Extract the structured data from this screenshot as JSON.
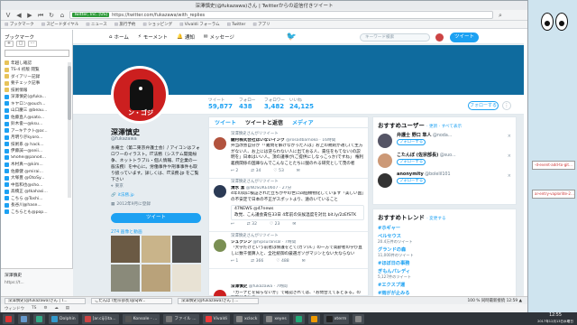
{
  "window_title": "深澤慎史(@fukazawa)さん | Twitterからの返信付きツイート",
  "url": {
    "badge": "Twitter, Inc. [US]",
    "text": "https://twitter.com/fukazawa/with_replies"
  },
  "bookmark_bar": [
    "ブックマーク",
    "スピードダイヤル",
    "ニュース",
    "旅行予約",
    "ショッピング",
    "Vivaldi フォーラム",
    "Twitter",
    "アプリ"
  ],
  "sidebar": {
    "title": "ブックマーク",
    "tools": [
      "+",
      "▢",
      "⋯"
    ],
    "items": [
      {
        "label": "年越し確認",
        "type": "folder"
      },
      {
        "label": "TS-4 初版 閲覧",
        "type": "folder"
      },
      {
        "label": "ダイアリー記録",
        "type": "folder"
      },
      {
        "label": "要チェック記事",
        "type": "folder"
      },
      {
        "label": "技術情報",
        "type": "folder"
      },
      {
        "label": "深澤慎史(@fuka...",
        "type": "link"
      },
      {
        "label": "キヤロン@ouch...",
        "type": "link"
      },
      {
        "label": "山口慶三 @beau...",
        "type": "link"
      },
      {
        "label": "佐藤直人@sato...",
        "type": "link"
      },
      {
        "label": "鈴木俊一@ksu...",
        "type": "link"
      },
      {
        "label": "アーキテクト@ar...",
        "type": "link"
      },
      {
        "label": "月明り＠kyoro...",
        "type": "link"
      },
      {
        "label": "技術系 @ hack...",
        "type": "link"
      },
      {
        "label": "伊藤誠一@seii...",
        "type": "link"
      },
      {
        "label": "Shohei@pano4...",
        "type": "link"
      },
      {
        "label": "木村真一@kim...",
        "type": "link"
      },
      {
        "label": "佐藤健 @mirai...",
        "type": "link"
      },
      {
        "label": "大塚豊 @OtoSy...",
        "type": "link"
      },
      {
        "label": "中島和也@sho...",
        "type": "link"
      },
      {
        "label": "高橋正 @tkahasi...",
        "type": "link"
      },
      {
        "label": "こちら @Toshi...",
        "type": "link"
      },
      {
        "label": "長谷川@hase...",
        "type": "link"
      },
      {
        "label": "こちらとも@pop...",
        "type": "link"
      }
    ],
    "dev_label": "深澤慎史",
    "dev_url": "https://t...",
    "dev_date": "2017年12月13日 12:55:22"
  },
  "twitter": {
    "nav": [
      {
        "icon": "⌂",
        "label": "ホーム"
      },
      {
        "icon": "⚡",
        "label": "モーメント"
      },
      {
        "icon": "🔔",
        "label": "通知"
      },
      {
        "icon": "✉",
        "label": "メッセージ"
      }
    ],
    "search_placeholder": "キーワード検索",
    "tweet_button": "ツイート",
    "stats": [
      {
        "label": "ツイート",
        "value": "59,877"
      },
      {
        "label": "フォロー",
        "value": "438"
      },
      {
        "label": "フォロワー",
        "value": "3,482"
      },
      {
        "label": "いいね",
        "value": "24,125"
      }
    ],
    "follow_button": "フォローする",
    "avatar_text": "ン・ゴジ",
    "profile": {
      "name": "深澤慎史",
      "handle": "@fukazawa",
      "bio": "糸庵士（第二東京弁護士会）/ アイコンはフォロワーのイラスト。IT法務（システム開発紛争、ネットトラブル・個人情報、IT企業の一般法務）を中心に。労働事件や刑事事件も取り扱っています。詳しくは、IT法務.jp をご覧下さい",
      "location": "東京",
      "link": "it法務.jp",
      "joined": "2012年9月に登録",
      "tweet_button": "ツイート",
      "media_label": "274 画像と動画"
    },
    "tabs": [
      "ツイート",
      "ツイートと返信",
      "メディア"
    ],
    "tweets": [
      {
        "rt": "深澤慎史さんがリツイート",
        "name": "鍵村株式会社はいないインク",
        "handle": "@rosadbamoko · 16時間",
        "text": "弁当改善自分が「「難問を解けなかった人は」お上の規則が適し(て生方がない人、お上には逆らわない人に出ておる人、責任をもてない)の説明を」日本はいい人。頂の議事が(ご提供にしなっこっか)ですね」 権利義務関係の国庫なんでこんなことたちに酸のれる研究として茂の者",
        "reply": "2",
        "rt_count": "34",
        "like": "53"
      },
      {
        "rt": "深澤慎史さんがリツイート",
        "name": "清水 潔",
        "handle": "@NOSUKE0607 · 27分",
        "text": "4年の間に検証された立ちがやの世に四個類物化しています「美しい国」の不安定で日本の不正がスポットより、遠のいていること",
        "extra": "47NEWS @47news\n政党、こん議会責任33日 4年前の気候温度を対比 bit.ly/2zEfSTK",
        "reply": "",
        "rt_count": "32",
        "like": "23"
      },
      {
        "rt": "深澤慎史さんがリツイート",
        "name": "シュクシン",
        "handle": "@hipsuransal · 7時間",
        "text": "「大学だけという前者は保護をとて(ガソ)ル」の一方で高齢者の学び直しに数千億算入と、全社統御の厳選ガソがマジンとない大ならない",
        "reply": "1",
        "rt_count": "366",
        "like": "488"
      },
      {
        "rt": "",
        "name": "深澤慎史",
        "handle": "@fukazawa · 7時間",
        "text": "「カーナビを知らないか」で確認されては、「お問合えてまとまる。の判断はそれる",
        "reply": "",
        "rt_count": "",
        "like": ""
      }
    ],
    "wtf": {
      "title": "おすすめユーザー",
      "more": "· 更新 · すべて表示",
      "users": [
        {
          "name": "弁護士 野口 隼人",
          "handle": "@noda...",
          "button": "フォローする"
        },
        {
          "name": "こたんぼ (佐宗部長)",
          "handle": "@suo...",
          "button": "フォローする"
        },
        {
          "name": "anonymity",
          "handle": "@bolelil101",
          "button": "フォローする"
        }
      ]
    },
    "trends": {
      "title": "おすすめトレンド",
      "more": "· 変更する",
      "items": [
        {
          "name": "#ホギャー",
          "count": ""
        },
        {
          "name": "ペルセウス",
          "count": "20.4万件のツイート"
        },
        {
          "name": "グランドの森",
          "count": "11,000件のツイート"
        },
        {
          "name": "#ほぼ日の事務",
          "count": ""
        },
        {
          "name": "ぎもんパレディ",
          "count": "5,127件のツイート"
        },
        {
          "name": "#エクスプ運",
          "count": ""
        },
        {
          "name": "#雨がが止みる",
          "count": "2,800件のツイート"
        },
        {
          "name": "ウインター",
          "count": ""
        }
      ]
    }
  },
  "status_tabs": [
    "深澤慎史(@fukazawa)さん | T...",
    "こたんぼ (佐宗部長)@SJW...",
    "深澤慎史(@fukazawa)さん | ..."
  ],
  "status_right": "100 %  同時最新接続  12:59 ▲",
  "browser_bottom": [
    "ウィンドウ",
    "TS",
    "⚙",
    "☁",
    "▤"
  ],
  "desktop": {
    "box1": "-d-event-add-to-github-pa...",
    "box2": "ar-entry-vaplorlite-2017/1"
  },
  "taskbar": [
    {
      "label": "",
      "color": "#d33"
    },
    {
      "label": "",
      "color": "#69c"
    },
    {
      "label": "",
      "color": "#3a8"
    },
    {
      "label": "Dolphin",
      "color": "#39c"
    },
    {
      "label": "[ar.ciji]ita...",
      "color": "#c44"
    },
    {
      "label": "Konsole - ...",
      "color": "#555"
    },
    {
      "label": "ファイル ...",
      "color": "#777"
    },
    {
      "label": "Vivaldi",
      "color": "#ef3939"
    },
    {
      "label": "xclock",
      "color": "#888"
    },
    {
      "label": "xeyes",
      "color": "#888"
    },
    {
      "label": "",
      "color": "#2a7"
    },
    {
      "label": "",
      "color": "#e90"
    },
    {
      "label": "xterm",
      "color": "#222"
    },
    {
      "label": "",
      "color": "#888"
    }
  ],
  "clock": {
    "time": "12:55",
    "date": "2017年12月13日水曜日"
  },
  "colors": {
    "twitter_blue": "#1da1f2",
    "banner": "#0f6b9e",
    "avatar_red": "#cc1f1f",
    "taskbar": "#2f343a"
  }
}
